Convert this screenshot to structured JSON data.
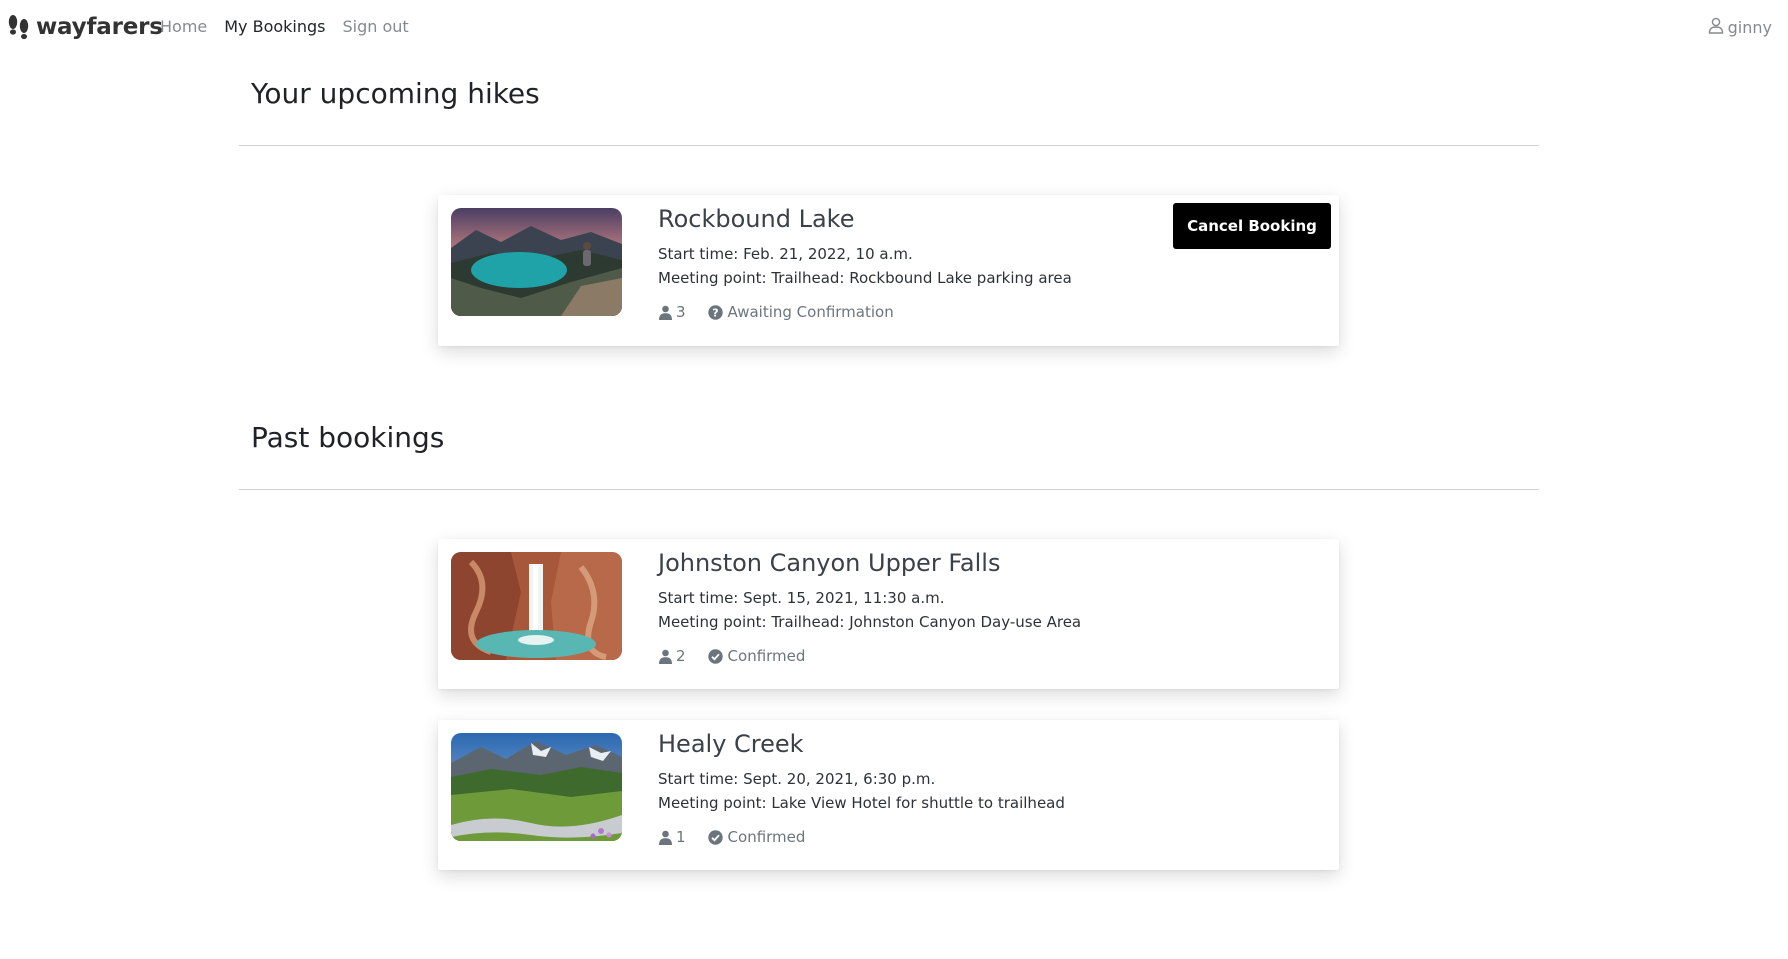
{
  "nav": {
    "brand": "wayfarers",
    "links": [
      "Home",
      "My Bookings",
      "Sign out"
    ],
    "active_link": "My Bookings",
    "user": "ginny"
  },
  "upcoming": {
    "title": "Your upcoming hikes",
    "bookings": [
      {
        "name": "Rockbound Lake",
        "start_time": "Start time: Feb. 21, 2022, 10 a.m.",
        "meeting_point": "Meeting point: Trailhead: Rockbound Lake parking area",
        "people": "3",
        "status": "Awaiting Confirmation",
        "status_icon": "question-circle-icon",
        "cancel_label": "Cancel Booking"
      }
    ]
  },
  "past": {
    "title": "Past bookings",
    "bookings": [
      {
        "name": "Johnston Canyon Upper Falls",
        "start_time": "Start time: Sept. 15, 2021, 11:30 a.m.",
        "meeting_point": "Meeting point: Trailhead: Johnston Canyon Day-use Area",
        "people": "2",
        "status": "Confirmed",
        "status_icon": "check-circle-icon"
      },
      {
        "name": "Healy Creek",
        "start_time": "Start time: Sept. 20, 2021, 6:30 p.m.",
        "meeting_point": "Meeting point: Lake View Hotel for shuttle to trailhead",
        "people": "1",
        "status": "Confirmed",
        "status_icon": "check-circle-icon"
      }
    ]
  }
}
